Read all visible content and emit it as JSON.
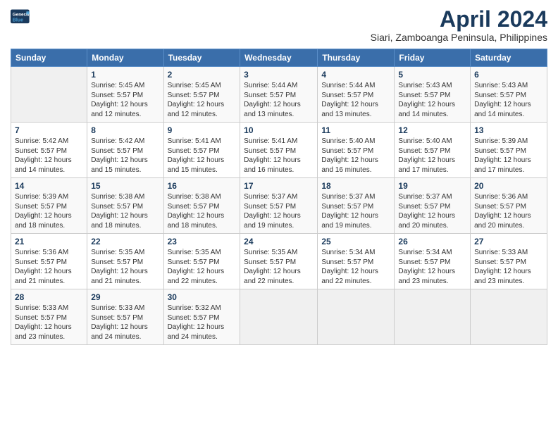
{
  "header": {
    "logo_line1": "General",
    "logo_line2": "Blue",
    "title": "April 2024",
    "subtitle": "Siari, Zamboanga Peninsula, Philippines"
  },
  "weekdays": [
    "Sunday",
    "Monday",
    "Tuesday",
    "Wednesday",
    "Thursday",
    "Friday",
    "Saturday"
  ],
  "weeks": [
    [
      {
        "day": "",
        "sunrise": "",
        "sunset": "",
        "daylight": ""
      },
      {
        "day": "1",
        "sunrise": "Sunrise: 5:45 AM",
        "sunset": "Sunset: 5:57 PM",
        "daylight": "Daylight: 12 hours and 12 minutes."
      },
      {
        "day": "2",
        "sunrise": "Sunrise: 5:45 AM",
        "sunset": "Sunset: 5:57 PM",
        "daylight": "Daylight: 12 hours and 12 minutes."
      },
      {
        "day": "3",
        "sunrise": "Sunrise: 5:44 AM",
        "sunset": "Sunset: 5:57 PM",
        "daylight": "Daylight: 12 hours and 13 minutes."
      },
      {
        "day": "4",
        "sunrise": "Sunrise: 5:44 AM",
        "sunset": "Sunset: 5:57 PM",
        "daylight": "Daylight: 12 hours and 13 minutes."
      },
      {
        "day": "5",
        "sunrise": "Sunrise: 5:43 AM",
        "sunset": "Sunset: 5:57 PM",
        "daylight": "Daylight: 12 hours and 14 minutes."
      },
      {
        "day": "6",
        "sunrise": "Sunrise: 5:43 AM",
        "sunset": "Sunset: 5:57 PM",
        "daylight": "Daylight: 12 hours and 14 minutes."
      }
    ],
    [
      {
        "day": "7",
        "sunrise": "Sunrise: 5:42 AM",
        "sunset": "Sunset: 5:57 PM",
        "daylight": "Daylight: 12 hours and 14 minutes."
      },
      {
        "day": "8",
        "sunrise": "Sunrise: 5:42 AM",
        "sunset": "Sunset: 5:57 PM",
        "daylight": "Daylight: 12 hours and 15 minutes."
      },
      {
        "day": "9",
        "sunrise": "Sunrise: 5:41 AM",
        "sunset": "Sunset: 5:57 PM",
        "daylight": "Daylight: 12 hours and 15 minutes."
      },
      {
        "day": "10",
        "sunrise": "Sunrise: 5:41 AM",
        "sunset": "Sunset: 5:57 PM",
        "daylight": "Daylight: 12 hours and 16 minutes."
      },
      {
        "day": "11",
        "sunrise": "Sunrise: 5:40 AM",
        "sunset": "Sunset: 5:57 PM",
        "daylight": "Daylight: 12 hours and 16 minutes."
      },
      {
        "day": "12",
        "sunrise": "Sunrise: 5:40 AM",
        "sunset": "Sunset: 5:57 PM",
        "daylight": "Daylight: 12 hours and 17 minutes."
      },
      {
        "day": "13",
        "sunrise": "Sunrise: 5:39 AM",
        "sunset": "Sunset: 5:57 PM",
        "daylight": "Daylight: 12 hours and 17 minutes."
      }
    ],
    [
      {
        "day": "14",
        "sunrise": "Sunrise: 5:39 AM",
        "sunset": "Sunset: 5:57 PM",
        "daylight": "Daylight: 12 hours and 18 minutes."
      },
      {
        "day": "15",
        "sunrise": "Sunrise: 5:38 AM",
        "sunset": "Sunset: 5:57 PM",
        "daylight": "Daylight: 12 hours and 18 minutes."
      },
      {
        "day": "16",
        "sunrise": "Sunrise: 5:38 AM",
        "sunset": "Sunset: 5:57 PM",
        "daylight": "Daylight: 12 hours and 18 minutes."
      },
      {
        "day": "17",
        "sunrise": "Sunrise: 5:37 AM",
        "sunset": "Sunset: 5:57 PM",
        "daylight": "Daylight: 12 hours and 19 minutes."
      },
      {
        "day": "18",
        "sunrise": "Sunrise: 5:37 AM",
        "sunset": "Sunset: 5:57 PM",
        "daylight": "Daylight: 12 hours and 19 minutes."
      },
      {
        "day": "19",
        "sunrise": "Sunrise: 5:37 AM",
        "sunset": "Sunset: 5:57 PM",
        "daylight": "Daylight: 12 hours and 20 minutes."
      },
      {
        "day": "20",
        "sunrise": "Sunrise: 5:36 AM",
        "sunset": "Sunset: 5:57 PM",
        "daylight": "Daylight: 12 hours and 20 minutes."
      }
    ],
    [
      {
        "day": "21",
        "sunrise": "Sunrise: 5:36 AM",
        "sunset": "Sunset: 5:57 PM",
        "daylight": "Daylight: 12 hours and 21 minutes."
      },
      {
        "day": "22",
        "sunrise": "Sunrise: 5:35 AM",
        "sunset": "Sunset: 5:57 PM",
        "daylight": "Daylight: 12 hours and 21 minutes."
      },
      {
        "day": "23",
        "sunrise": "Sunrise: 5:35 AM",
        "sunset": "Sunset: 5:57 PM",
        "daylight": "Daylight: 12 hours and 22 minutes."
      },
      {
        "day": "24",
        "sunrise": "Sunrise: 5:35 AM",
        "sunset": "Sunset: 5:57 PM",
        "daylight": "Daylight: 12 hours and 22 minutes."
      },
      {
        "day": "25",
        "sunrise": "Sunrise: 5:34 AM",
        "sunset": "Sunset: 5:57 PM",
        "daylight": "Daylight: 12 hours and 22 minutes."
      },
      {
        "day": "26",
        "sunrise": "Sunrise: 5:34 AM",
        "sunset": "Sunset: 5:57 PM",
        "daylight": "Daylight: 12 hours and 23 minutes."
      },
      {
        "day": "27",
        "sunrise": "Sunrise: 5:33 AM",
        "sunset": "Sunset: 5:57 PM",
        "daylight": "Daylight: 12 hours and 23 minutes."
      }
    ],
    [
      {
        "day": "28",
        "sunrise": "Sunrise: 5:33 AM",
        "sunset": "Sunset: 5:57 PM",
        "daylight": "Daylight: 12 hours and 23 minutes."
      },
      {
        "day": "29",
        "sunrise": "Sunrise: 5:33 AM",
        "sunset": "Sunset: 5:57 PM",
        "daylight": "Daylight: 12 hours and 24 minutes."
      },
      {
        "day": "30",
        "sunrise": "Sunrise: 5:32 AM",
        "sunset": "Sunset: 5:57 PM",
        "daylight": "Daylight: 12 hours and 24 minutes."
      },
      {
        "day": "",
        "sunrise": "",
        "sunset": "",
        "daylight": ""
      },
      {
        "day": "",
        "sunrise": "",
        "sunset": "",
        "daylight": ""
      },
      {
        "day": "",
        "sunrise": "",
        "sunset": "",
        "daylight": ""
      },
      {
        "day": "",
        "sunrise": "",
        "sunset": "",
        "daylight": ""
      }
    ]
  ]
}
